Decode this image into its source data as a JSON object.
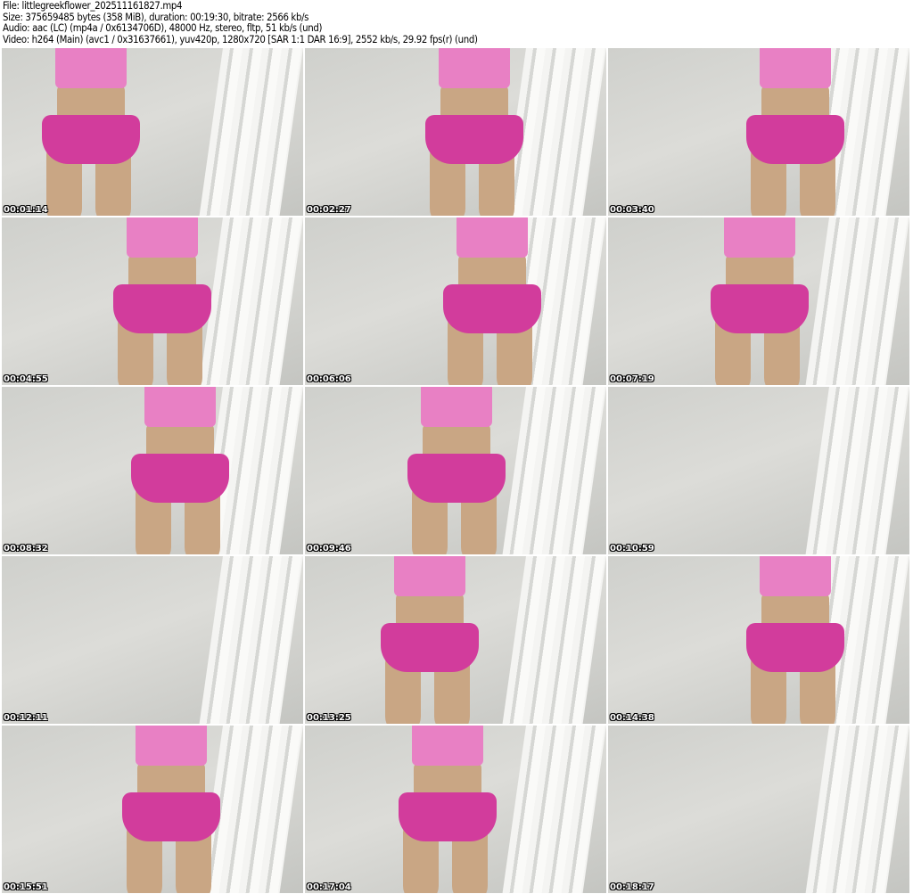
{
  "header": {
    "file": "File: littlegreekflower_202511161827.mp4",
    "size": "Size: 375659485 bytes (358 MiB), duration: 00:19:30, bitrate: 2566 kb/s",
    "audio": "Audio: aac (LC) (mp4a / 0x6134706D), 48000 Hz, stereo, fltp, 51 kb/s (und)",
    "video": "Video: h264 (Main) (avc1 / 0x31637661), yuv420p, 1280x720 [SAR 1:1 DAR 16:9], 2552 kb/s, 29.92 fps(r) (und)"
  },
  "thumbnails": [
    {
      "timestamp": "00:01:14",
      "figure": true
    },
    {
      "timestamp": "00:02:27",
      "figure": true
    },
    {
      "timestamp": "00:03:40",
      "figure": true
    },
    {
      "timestamp": "00:04:55",
      "figure": true
    },
    {
      "timestamp": "00:06:06",
      "figure": true
    },
    {
      "timestamp": "00:07:19",
      "figure": true
    },
    {
      "timestamp": "00:08:32",
      "figure": true
    },
    {
      "timestamp": "00:09:46",
      "figure": true
    },
    {
      "timestamp": "00:10:59",
      "figure": false
    },
    {
      "timestamp": "00:12:11",
      "figure": false
    },
    {
      "timestamp": "00:13:25",
      "figure": true
    },
    {
      "timestamp": "00:14:38",
      "figure": true
    },
    {
      "timestamp": "00:15:51",
      "figure": true
    },
    {
      "timestamp": "00:17:04",
      "figure": true
    },
    {
      "timestamp": "00:18:17",
      "figure": false
    }
  ]
}
